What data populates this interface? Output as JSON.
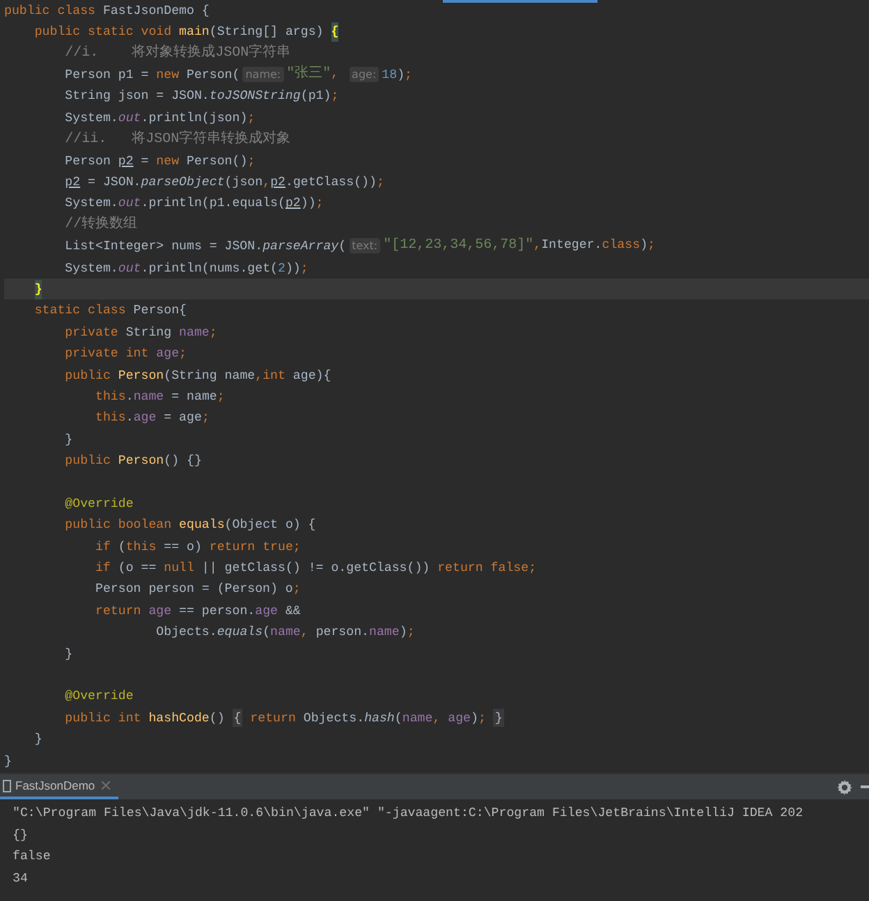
{
  "editor": {
    "lines": [
      {
        "current": false,
        "tokens": [
          {
            "kind": "keyword",
            "text": "public class "
          },
          {
            "kind": "plain",
            "text": "FastJsonDemo {"
          }
        ]
      },
      {
        "current": false,
        "tokens": [
          {
            "kind": "keyword",
            "text": "    public static void "
          },
          {
            "kind": "declaration",
            "text": "main"
          },
          {
            "kind": "plain",
            "text": "(String[] args) "
          },
          {
            "kind": "matched-brace",
            "text": "{"
          }
        ]
      },
      {
        "current": false,
        "tokens": [
          {
            "kind": "comment",
            "text": "        //i.    将对象转换成JSON字符串"
          }
        ]
      },
      {
        "current": false,
        "tokens": [
          {
            "kind": "plain",
            "text": "        Person p1 = "
          },
          {
            "kind": "keyword",
            "text": "new "
          },
          {
            "kind": "plain",
            "text": "Person("
          },
          {
            "kind": "hint",
            "text": "name:"
          },
          {
            "kind": "string",
            "text": "\"张三\""
          },
          {
            "kind": "keyword",
            "text": ", "
          },
          {
            "kind": "hint",
            "text": "age:"
          },
          {
            "kind": "number",
            "text": "18"
          },
          {
            "kind": "plain",
            "text": ")"
          },
          {
            "kind": "keyword",
            "text": ";"
          }
        ]
      },
      {
        "current": false,
        "tokens": [
          {
            "kind": "plain",
            "text": "        String json = JSON."
          },
          {
            "kind": "static-call",
            "text": "toJSONString"
          },
          {
            "kind": "plain",
            "text": "(p1)"
          },
          {
            "kind": "keyword",
            "text": ";"
          }
        ]
      },
      {
        "current": false,
        "tokens": [
          {
            "kind": "plain",
            "text": "        System."
          },
          {
            "kind": "static-field",
            "text": "out"
          },
          {
            "kind": "plain",
            "text": ".println(json)"
          },
          {
            "kind": "keyword",
            "text": ";"
          }
        ]
      },
      {
        "current": false,
        "tokens": [
          {
            "kind": "comment",
            "text": "        //ii.   将JSON字符串转换成对象"
          }
        ]
      },
      {
        "current": false,
        "tokens": [
          {
            "kind": "plain",
            "text": "        Person "
          },
          {
            "kind": "reassigned",
            "text": "p2"
          },
          {
            "kind": "plain",
            "text": " = "
          },
          {
            "kind": "keyword",
            "text": "new "
          },
          {
            "kind": "plain",
            "text": "Person()"
          },
          {
            "kind": "keyword",
            "text": ";"
          }
        ]
      },
      {
        "current": false,
        "tokens": [
          {
            "kind": "reassigned",
            "text": "        p2"
          },
          {
            "kind": "plain",
            "text": " = JSON."
          },
          {
            "kind": "static-call",
            "text": "parseObject"
          },
          {
            "kind": "plain",
            "text": "(json"
          },
          {
            "kind": "keyword",
            "text": ","
          },
          {
            "kind": "reassigned",
            "text": "p2"
          },
          {
            "kind": "plain",
            "text": ".getClass())"
          },
          {
            "kind": "keyword",
            "text": ";"
          }
        ]
      },
      {
        "current": false,
        "tokens": [
          {
            "kind": "plain",
            "text": "        System."
          },
          {
            "kind": "static-field",
            "text": "out"
          },
          {
            "kind": "plain",
            "text": ".println(p1.equals("
          },
          {
            "kind": "reassigned",
            "text": "p2"
          },
          {
            "kind": "plain",
            "text": "))"
          },
          {
            "kind": "keyword",
            "text": ";"
          }
        ]
      },
      {
        "current": false,
        "tokens": [
          {
            "kind": "comment",
            "text": "        //转换数组"
          }
        ]
      },
      {
        "current": false,
        "tokens": [
          {
            "kind": "plain",
            "text": "        List<Integer> nums = JSON."
          },
          {
            "kind": "static-call",
            "text": "parseArray"
          },
          {
            "kind": "plain",
            "text": "("
          },
          {
            "kind": "hint",
            "text": "text:"
          },
          {
            "kind": "string",
            "text": "\"[12,23,34,56,78]\""
          },
          {
            "kind": "keyword",
            "text": ","
          },
          {
            "kind": "plain",
            "text": "Integer."
          },
          {
            "kind": "keyword",
            "text": "class"
          },
          {
            "kind": "plain",
            "text": ")"
          },
          {
            "kind": "keyword",
            "text": ";"
          }
        ]
      },
      {
        "current": false,
        "tokens": [
          {
            "kind": "plain",
            "text": "        System."
          },
          {
            "kind": "static-field",
            "text": "out"
          },
          {
            "kind": "plain",
            "text": ".println(nums.get("
          },
          {
            "kind": "number",
            "text": "2"
          },
          {
            "kind": "plain",
            "text": "))"
          },
          {
            "kind": "keyword",
            "text": ";"
          }
        ]
      },
      {
        "current": true,
        "tokens": [
          {
            "kind": "matched-brace",
            "text": "    }"
          }
        ]
      },
      {
        "current": false,
        "tokens": [
          {
            "kind": "keyword",
            "text": "    static class "
          },
          {
            "kind": "plain",
            "text": "Person{"
          }
        ]
      },
      {
        "current": false,
        "tokens": [
          {
            "kind": "keyword",
            "text": "        private "
          },
          {
            "kind": "plain",
            "text": "String "
          },
          {
            "kind": "field",
            "text": "name"
          },
          {
            "kind": "keyword",
            "text": ";"
          }
        ]
      },
      {
        "current": false,
        "tokens": [
          {
            "kind": "keyword",
            "text": "        private int "
          },
          {
            "kind": "field",
            "text": "age"
          },
          {
            "kind": "keyword",
            "text": ";"
          }
        ]
      },
      {
        "current": false,
        "tokens": [
          {
            "kind": "keyword",
            "text": "        public "
          },
          {
            "kind": "declaration",
            "text": "Person"
          },
          {
            "kind": "plain",
            "text": "(String name"
          },
          {
            "kind": "keyword",
            "text": ",int "
          },
          {
            "kind": "plain",
            "text": "age){"
          }
        ]
      },
      {
        "current": false,
        "tokens": [
          {
            "kind": "keyword",
            "text": "            this"
          },
          {
            "kind": "plain",
            "text": "."
          },
          {
            "kind": "field",
            "text": "name"
          },
          {
            "kind": "plain",
            "text": " = name"
          },
          {
            "kind": "keyword",
            "text": ";"
          }
        ]
      },
      {
        "current": false,
        "tokens": [
          {
            "kind": "keyword",
            "text": "            this"
          },
          {
            "kind": "plain",
            "text": "."
          },
          {
            "kind": "field",
            "text": "age"
          },
          {
            "kind": "plain",
            "text": " = age"
          },
          {
            "kind": "keyword",
            "text": ";"
          }
        ]
      },
      {
        "current": false,
        "tokens": [
          {
            "kind": "plain",
            "text": "        }"
          }
        ]
      },
      {
        "current": false,
        "tokens": [
          {
            "kind": "keyword",
            "text": "        public "
          },
          {
            "kind": "declaration",
            "text": "Person"
          },
          {
            "kind": "plain",
            "text": "() {}"
          }
        ]
      },
      {
        "current": false
      },
      {
        "current": false,
        "tokens": [
          {
            "kind": "annotation",
            "text": "        @Override"
          }
        ]
      },
      {
        "current": false,
        "tokens": [
          {
            "kind": "keyword",
            "text": "        public boolean "
          },
          {
            "kind": "declaration",
            "text": "equals"
          },
          {
            "kind": "plain",
            "text": "(Object o) {"
          }
        ]
      },
      {
        "current": false,
        "tokens": [
          {
            "kind": "keyword",
            "text": "            if "
          },
          {
            "kind": "plain",
            "text": "("
          },
          {
            "kind": "keyword",
            "text": "this "
          },
          {
            "kind": "plain",
            "text": "== o) "
          },
          {
            "kind": "keyword",
            "text": "return true;"
          }
        ]
      },
      {
        "current": false,
        "tokens": [
          {
            "kind": "keyword",
            "text": "            if "
          },
          {
            "kind": "plain",
            "text": "(o == "
          },
          {
            "kind": "keyword",
            "text": "null "
          },
          {
            "kind": "plain",
            "text": "|| getClass() != o.getClass()) "
          },
          {
            "kind": "keyword",
            "text": "return false;"
          }
        ]
      },
      {
        "current": false,
        "tokens": [
          {
            "kind": "plain",
            "text": "            Person person = (Person) o"
          },
          {
            "kind": "keyword",
            "text": ";"
          }
        ]
      },
      {
        "current": false,
        "tokens": [
          {
            "kind": "keyword",
            "text": "            return "
          },
          {
            "kind": "field",
            "text": "age"
          },
          {
            "kind": "plain",
            "text": " == person."
          },
          {
            "kind": "field",
            "text": "age"
          },
          {
            "kind": "plain",
            "text": " &&"
          }
        ]
      },
      {
        "current": false,
        "tokens": [
          {
            "kind": "plain",
            "text": "                    Objects."
          },
          {
            "kind": "static-call",
            "text": "equals"
          },
          {
            "kind": "plain",
            "text": "("
          },
          {
            "kind": "field",
            "text": "name"
          },
          {
            "kind": "keyword",
            "text": ", "
          },
          {
            "kind": "plain",
            "text": "person."
          },
          {
            "kind": "field",
            "text": "name"
          },
          {
            "kind": "plain",
            "text": ")"
          },
          {
            "kind": "keyword",
            "text": ";"
          }
        ]
      },
      {
        "current": false,
        "tokens": [
          {
            "kind": "plain",
            "text": "        }"
          }
        ]
      },
      {
        "current": false
      },
      {
        "current": false,
        "tokens": [
          {
            "kind": "annotation",
            "text": "        @Override"
          }
        ]
      },
      {
        "current": false,
        "tokens": [
          {
            "kind": "keyword",
            "text": "        public int "
          },
          {
            "kind": "declaration",
            "text": "hashCode"
          },
          {
            "kind": "plain",
            "text": "() "
          },
          {
            "kind": "folded",
            "text": "{"
          },
          {
            "kind": "keyword",
            "text": " return "
          },
          {
            "kind": "plain",
            "text": "Objects."
          },
          {
            "kind": "static-call",
            "text": "hash"
          },
          {
            "kind": "plain",
            "text": "("
          },
          {
            "kind": "field",
            "text": "name"
          },
          {
            "kind": "keyword",
            "text": ", "
          },
          {
            "kind": "field",
            "text": "age"
          },
          {
            "kind": "plain",
            "text": ")"
          },
          {
            "kind": "keyword",
            "text": "; "
          },
          {
            "kind": "folded",
            "text": "}"
          }
        ]
      },
      {
        "current": false,
        "tokens": [
          {
            "kind": "plain",
            "text": "    }"
          }
        ]
      },
      {
        "current": false,
        "tokens": [
          {
            "kind": "plain",
            "text": "}"
          }
        ]
      }
    ]
  },
  "run_panel": {
    "tabs": [
      {
        "label": "FastJsonDemo",
        "selected": true
      }
    ],
    "output": [
      "\"C:\\Program Files\\Java\\jdk-11.0.6\\bin\\java.exe\" \"-javaagent:C:\\Program Files\\JetBrains\\IntelliJ IDEA 202",
      "{}",
      "false",
      "34"
    ]
  }
}
